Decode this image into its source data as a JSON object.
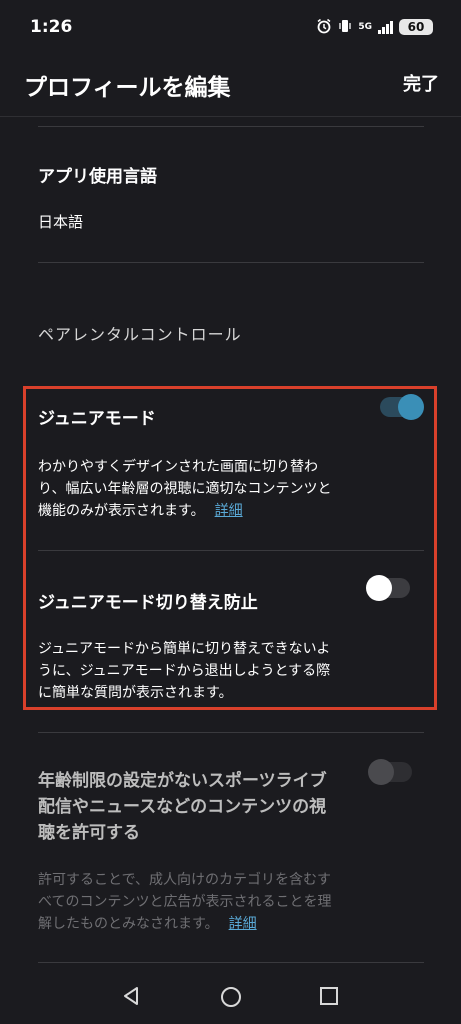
{
  "status": {
    "time": "1:26",
    "network": "5G",
    "battery": "60"
  },
  "header": {
    "title": "プロフィールを編集",
    "done_label": "完了"
  },
  "language": {
    "title": "アプリ使用言語",
    "value": "日本語"
  },
  "parental": {
    "label": "ペアレンタルコントロール"
  },
  "junior_mode": {
    "title": "ジュニアモード",
    "desc_line1": "わかりやすくデザインされた画面に切り替わ",
    "desc_line2": "り、幅広い年齢層の視聴に適切なコンテンツと",
    "desc_line3": "機能のみが表示されます。",
    "detail_label": "詳細",
    "enabled": true
  },
  "switch_lock": {
    "title": "ジュニアモード切り替え防止",
    "desc_line1": "ジュニアモードから簡単に切り替えできないよ",
    "desc_line2": "うに、ジュニアモードから退出しようとする際",
    "desc_line3": "に簡単な質問が表示されます。",
    "enabled": false
  },
  "sports_live": {
    "title_line1": "年齢制限の設定がないスポーツライブ",
    "title_line2": "配信やニュースなどのコンテンツの視",
    "title_line3": "聴を許可する",
    "desc_line1": "許可することで、成人向けのカテゴリを含むす",
    "desc_line2": "べてのコンテンツと広告が表示されることを理",
    "desc_line3": "解したものとみなされます。",
    "detail_label": "詳細",
    "enabled": false,
    "disabled": true
  },
  "colors": {
    "background": "#1b1b1f",
    "highlight_border": "#d9402b",
    "link": "#5aa9d6",
    "toggle_on": "#3a8fb7"
  }
}
